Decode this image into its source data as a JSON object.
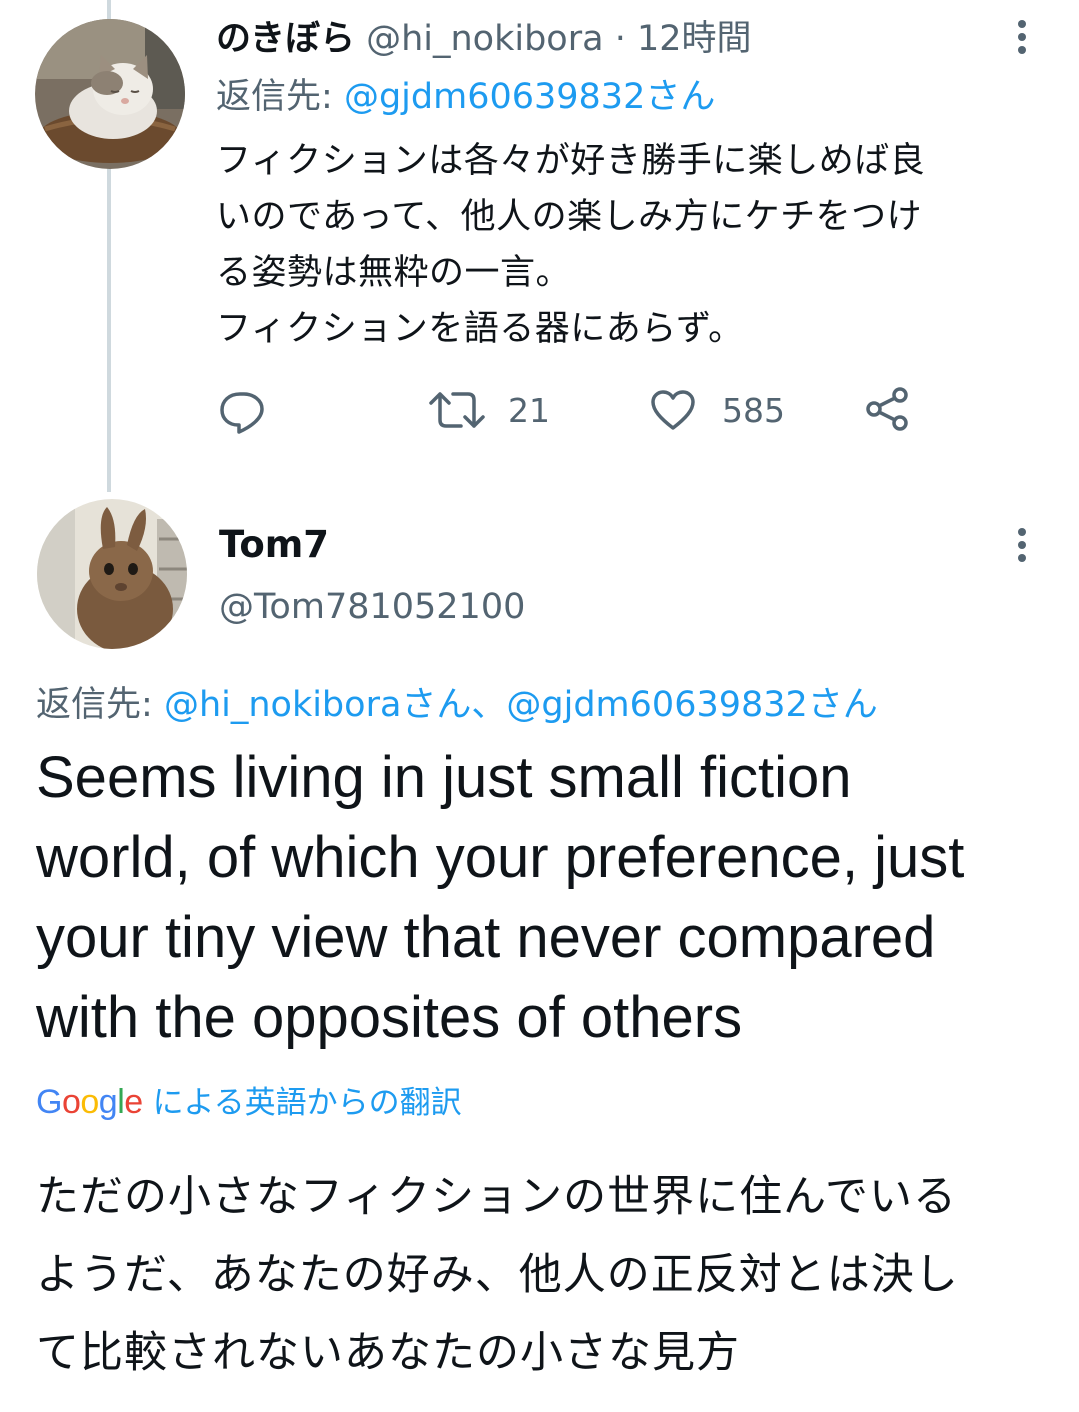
{
  "tweet1": {
    "display_name": "のきぼら",
    "handle": "@hi_nokibora",
    "separator": "·",
    "time": "12時間",
    "reply_prefix": "返信先:",
    "reply_to": "@gjdm60639832さん",
    "text_lines": [
      "フィクションは各々が好き勝手に楽しめば良",
      "いのであって、他人の楽しみ方にケチをつけ",
      "る姿勢は無粋の一言。",
      "フィクションを語る器にあらず。"
    ],
    "retweet_count": "21",
    "like_count": "585",
    "avatar_icon": "cat-photo"
  },
  "tweet2": {
    "display_name": "Tom7",
    "handle": "@Tom781052100",
    "reply_prefix": "返信先:",
    "reply_to": "@hi_nokiboraさん、@gjdm60639832さん",
    "text_lines": [
      "Seems living in just small fiction",
      "world, of which your preference, just",
      "your tiny view that never compared",
      "with the opposites of others"
    ],
    "translation_brand": "Google",
    "translation_label": "による英語からの翻訳",
    "translation_lines": [
      "ただの小さなフィクションの世界に住んでいる",
      "ようだ、あなたの好み、他人の正反対とは決し",
      "て比較されないあなたの小さな見方"
    ],
    "avatar_icon": "rabbit-photo"
  },
  "colors": {
    "text": "#0f1419",
    "secondary": "#536471",
    "link": "#1d9bf0",
    "thread_line": "#cfd9de",
    "google_blue": "#4285F4",
    "google_red": "#EA4335",
    "google_yellow": "#FBBC05",
    "google_green": "#34A853"
  }
}
